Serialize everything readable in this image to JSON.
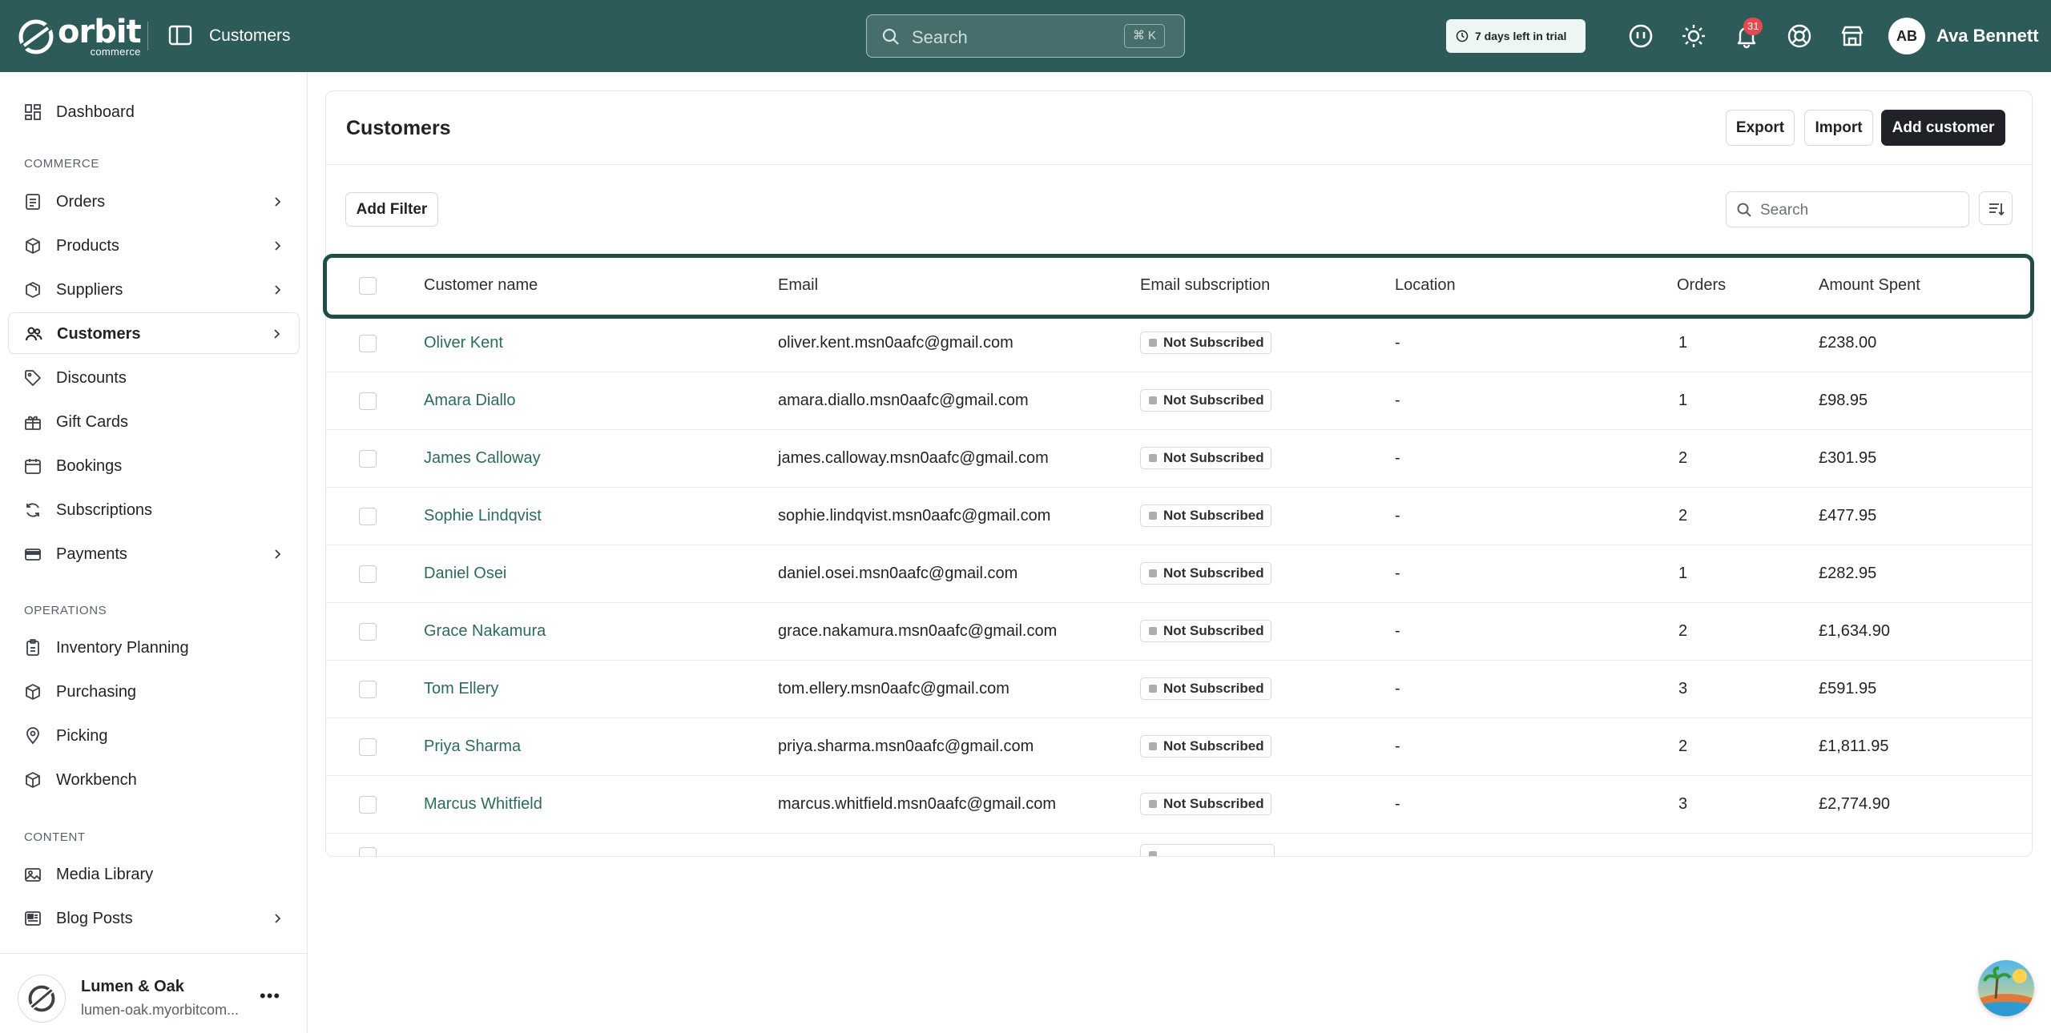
{
  "brand": {
    "word": "orbit",
    "sub": "commerce"
  },
  "header": {
    "title": "Customers",
    "search_placeholder": "Search",
    "shortcut": "⌘ K",
    "trial_text": "7 days left in trial",
    "notification_count": "31",
    "user_initials": "AB",
    "user_name": "Ava Bennett",
    "accent_color": "#2d5b59"
  },
  "sidebar": {
    "items": [
      {
        "label": "Dashboard",
        "icon": "dashboard-icon"
      },
      {
        "label": "Orders",
        "icon": "orders-icon"
      },
      {
        "label": "Products",
        "icon": "products-icon"
      },
      {
        "label": "Suppliers",
        "icon": "suppliers-icon"
      },
      {
        "label": "Customers",
        "icon": "customers-icon"
      },
      {
        "label": "Discounts",
        "icon": "discounts-icon"
      },
      {
        "label": "Gift Cards",
        "icon": "gift-card-icon"
      },
      {
        "label": "Bookings",
        "icon": "bookings-icon"
      },
      {
        "label": "Subscriptions",
        "icon": "subscriptions-icon"
      },
      {
        "label": "Payments",
        "icon": "payments-icon"
      },
      {
        "label": "Inventory Planning",
        "icon": "inventory-icon"
      },
      {
        "label": "Purchasing",
        "icon": "purchasing-icon"
      },
      {
        "label": "Picking",
        "icon": "picking-icon"
      },
      {
        "label": "Workbench",
        "icon": "workbench-icon"
      },
      {
        "label": "Media Library",
        "icon": "media-icon"
      },
      {
        "label": "Blog Posts",
        "icon": "blog-icon"
      }
    ],
    "sections": {
      "commerce": "COMMERCE",
      "operations": "OPERATIONS",
      "content": "CONTENT"
    },
    "store": {
      "name": "Lumen & Oak",
      "url": "lumen-oak.myorbitcom..."
    }
  },
  "main": {
    "title": "Customers",
    "buttons": {
      "export": "Export",
      "import": "Import",
      "add": "Add customer",
      "filter": "Add Filter"
    },
    "search_placeholder": "Search",
    "columns": [
      "Customer name",
      "Email",
      "Email subscription",
      "Location",
      "Orders",
      "Amount Spent"
    ],
    "rows": [
      {
        "name": "Oliver Kent",
        "email": "oliver.kent.msn0aafc@gmail.com",
        "subscription": "Not Subscribed",
        "location": "-",
        "orders": "1",
        "amount": "£238.00"
      },
      {
        "name": "Amara Diallo",
        "email": "amara.diallo.msn0aafc@gmail.com",
        "subscription": "Not Subscribed",
        "location": "-",
        "orders": "1",
        "amount": "£98.95"
      },
      {
        "name": "James Calloway",
        "email": "james.calloway.msn0aafc@gmail.com",
        "subscription": "Not Subscribed",
        "location": "-",
        "orders": "2",
        "amount": "£301.95"
      },
      {
        "name": "Sophie Lindqvist",
        "email": "sophie.lindqvist.msn0aafc@gmail.com",
        "subscription": "Not Subscribed",
        "location": "-",
        "orders": "2",
        "amount": "£477.95"
      },
      {
        "name": "Daniel Osei",
        "email": "daniel.osei.msn0aafc@gmail.com",
        "subscription": "Not Subscribed",
        "location": "-",
        "orders": "1",
        "amount": "£282.95"
      },
      {
        "name": "Grace Nakamura",
        "email": "grace.nakamura.msn0aafc@gmail.com",
        "subscription": "Not Subscribed",
        "location": "-",
        "orders": "2",
        "amount": "£1,634.90"
      },
      {
        "name": "Tom Ellery",
        "email": "tom.ellery.msn0aafc@gmail.com",
        "subscription": "Not Subscribed",
        "location": "-",
        "orders": "3",
        "amount": "£591.95"
      },
      {
        "name": "Priya Sharma",
        "email": "priya.sharma.msn0aafc@gmail.com",
        "subscription": "Not Subscribed",
        "location": "-",
        "orders": "2",
        "amount": "£1,811.95"
      },
      {
        "name": "Marcus Whitfield",
        "email": "marcus.whitfield.msn0aafc@gmail.com",
        "subscription": "Not Subscribed",
        "location": "-",
        "orders": "3",
        "amount": "£2,774.90"
      }
    ]
  }
}
